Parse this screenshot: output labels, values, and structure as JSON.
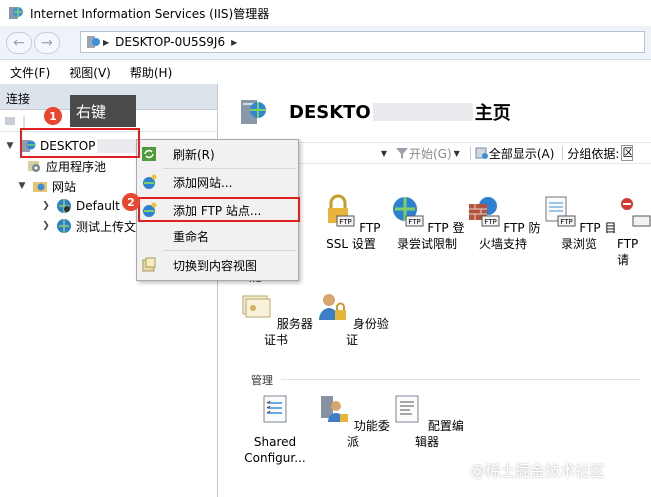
{
  "window": {
    "title": "Internet Information Services (IIS)管理器"
  },
  "address": {
    "segments": [
      "DESKTOP-0U5S9J6"
    ]
  },
  "menu": [
    "文件(F)",
    "视图(V)",
    "帮助(H)"
  ],
  "connections": {
    "header": "连接",
    "tree": [
      {
        "label": "DESKTOP",
        "level": 0
      },
      {
        "label": "应用程序池",
        "level": 1
      },
      {
        "label": "网站",
        "level": 1
      },
      {
        "label": "Default W",
        "level": 2
      },
      {
        "label": "测试上传文",
        "level": 2
      }
    ]
  },
  "main": {
    "title_prefix": "DESKTO",
    "title_suffix": "主页",
    "toolbar": {
      "start": "开始(G)",
      "show_all": "全部显示(A)",
      "group_by": "分组依据:",
      "group_value": "区"
    },
    "groups": [
      {
        "label": "IIS"
      },
      {
        "label": "管理"
      }
    ],
    "features": [
      {
        "id": "partial",
        "label": "址"
      },
      {
        "id": "ftp-ssl",
        "label": "FTP SSL 设置"
      },
      {
        "id": "ftp-login",
        "label": "FTP 登录尝试限制"
      },
      {
        "id": "ftp-firewall",
        "label": "FTP 防火墙支持"
      },
      {
        "id": "ftp-dir",
        "label": "FTP 目录浏览"
      },
      {
        "id": "ftp-more",
        "label": "FTP 请"
      },
      {
        "id": "server-cert",
        "label": "服务器证书"
      },
      {
        "id": "auth",
        "label": "身份验证"
      },
      {
        "id": "shared-config",
        "label": "Shared Configur..."
      },
      {
        "id": "delegation",
        "label": "功能委派"
      },
      {
        "id": "config-editor",
        "label": "配置编辑器"
      }
    ]
  },
  "context_menu": {
    "items": [
      "刷新(R)",
      "添加网站...",
      "添加 FTP 站点...",
      "重命名",
      "切换到内容视图"
    ]
  },
  "annotations": {
    "badge1": "1",
    "badge2": "2",
    "tooltip": "右键"
  },
  "watermark": "@稀土掘金技术社区"
}
